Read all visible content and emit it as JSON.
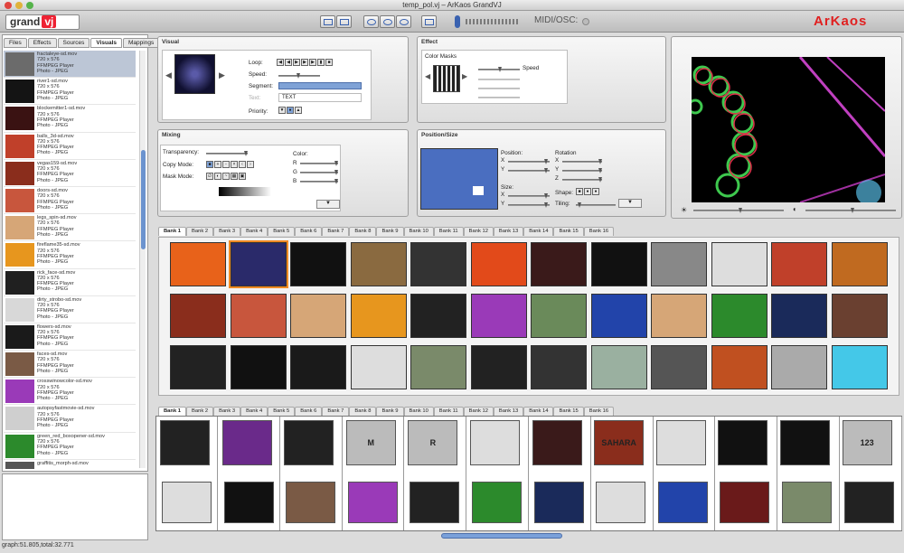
{
  "window": {
    "title": "temp_pol.vj – ArKaos GrandVJ"
  },
  "toolbar": {
    "logo_text": "grand",
    "logo_badge": "vj",
    "midi_label": "MIDI/OSC:",
    "brand": "ArKaos"
  },
  "left_tabs": [
    {
      "label": "Files"
    },
    {
      "label": "Effects"
    },
    {
      "label": "Sources"
    },
    {
      "label": "Visuals"
    },
    {
      "label": "Mappings"
    }
  ],
  "media": [
    {
      "name": "fractaleye-sd.mov",
      "size": "720 x 576",
      "player": "FFMPEG Player",
      "type": "Photo - JPEG",
      "color": "#6b6b6b"
    },
    {
      "name": "river1-sd.mov",
      "size": "720 x 576",
      "player": "FFMPEG Player",
      "type": "Photo - JPEG",
      "color": "#141414"
    },
    {
      "name": "blockemitter1-sd.mov",
      "size": "720 x 576",
      "player": "FFMPEG Player",
      "type": "Photo - JPEG",
      "color": "#3a1212"
    },
    {
      "name": "balls_3d-sd.mov",
      "size": "720 x 576",
      "player": "FFMPEG Player",
      "type": "Photo - JPEG",
      "color": "#c0402a"
    },
    {
      "name": "vegas159-sd.mov",
      "size": "720 x 576",
      "player": "FFMPEG Player",
      "type": "Photo - JPEG",
      "color": "#8a2d1c"
    },
    {
      "name": "doors-sd.mov",
      "size": "720 x 576",
      "player": "FFMPEG Player",
      "type": "Photo - JPEG",
      "color": "#c8563d"
    },
    {
      "name": "legs_spin-sd.mov",
      "size": "720 x 576",
      "player": "FFMPEG Player",
      "type": "Photo - JPEG",
      "color": "#d6a677"
    },
    {
      "name": "fireflame35-sd.mov",
      "size": "720 x 576",
      "player": "FFMPEG Player",
      "type": "Photo - JPEG",
      "color": "#e7961e"
    },
    {
      "name": "rick_face-sd.mov",
      "size": "720 x 576",
      "player": "FFMPEG Player",
      "type": "Photo - JPEG",
      "color": "#202020"
    },
    {
      "name": "dirty_strobo-sd.mov",
      "size": "720 x 576",
      "player": "FFMPEG Player",
      "type": "Photo - JPEG",
      "color": "#d8d8d8"
    },
    {
      "name": "flowers-sd.mov",
      "size": "720 x 576",
      "player": "FFMPEG Player",
      "type": "Photo - JPEG",
      "color": "#1a1a1a"
    },
    {
      "name": "faces-sd.mov",
      "size": "720 x 576",
      "player": "FFMPEG Player",
      "type": "Photo - JPEG",
      "color": "#7a5a45"
    },
    {
      "name": "crosswinowcolor-sd.mov",
      "size": "720 x 576",
      "player": "FFMPEG Player",
      "type": "Photo - JPEG",
      "color": "#9a3ab8"
    },
    {
      "name": "autopsyfastmovie-sd.mov",
      "size": "720 x 576",
      "player": "FFMPEG Player",
      "type": "Photo - JPEG",
      "color": "#cfcfcf"
    },
    {
      "name": "green_red_boxopener-sd.mov",
      "size": "720 x 576",
      "player": "FFMPEG Player",
      "type": "Photo - JPEG",
      "color": "#2c8a2c"
    },
    {
      "name": "graffitis_morph-sd.mov",
      "size": "",
      "player": "",
      "type": "",
      "color": "#555"
    }
  ],
  "status": "graph:51.805,total:32.771",
  "visual": {
    "header": "Visual",
    "loop": "Loop:",
    "speed": "Speed:",
    "segment": "Segment:",
    "text_lbl": "Text:",
    "text_value": "TEXT",
    "priority": "Priority:"
  },
  "effect": {
    "header": "Effect",
    "mask_label": "Color Masks",
    "speed": "Speed"
  },
  "mixing": {
    "header": "Mixing",
    "transparency": "Transparency:",
    "copy": "Copy Mode:",
    "mask": "Mask Mode:",
    "color": "Color:",
    "r": "R",
    "g": "G",
    "b": "B"
  },
  "position": {
    "header": "Position/Size",
    "position": "Position:",
    "rotation": "Rotation",
    "size": "Size:",
    "shape": "Shape:",
    "tiling": "Tiling:",
    "x": "X",
    "y": "Y",
    "z": "Z"
  },
  "banks": [
    "Bank 1",
    "Bank 2",
    "Bank 3",
    "Bank 4",
    "Bank 5",
    "Bank 6",
    "Bank 7",
    "Bank 8",
    "Bank 9",
    "Bank 10",
    "Bank 11",
    "Bank 12",
    "Bank 13",
    "Bank 14",
    "Bank 15",
    "Bank 16"
  ],
  "grid_colors": [
    "#e8621a",
    "#2a2a6a",
    "#111",
    "#8a6a40",
    "#333",
    "#e24a1a",
    "#3a1a1a",
    "#111",
    "#888",
    "#ddd",
    "#c0402a",
    "#c06a20",
    "#8a2d1c",
    "#c8563d",
    "#d6a677",
    "#e7961e",
    "#222",
    "#9a3ab8",
    "#6a8a5a",
    "#2244aa",
    "#d6a677",
    "#2c8a2c",
    "#1a2a5a",
    "#6a4030",
    "#222",
    "#111",
    "#1a1a1a",
    "#ddd",
    "#7a8a6a",
    "#222",
    "#333",
    "#9ab0a0",
    "#555",
    "#c05020",
    "#aaa",
    "#44c8e8"
  ],
  "key_top": [
    {
      "label": "",
      "color": "#222"
    },
    {
      "label": "",
      "color": "#6a2a8a"
    },
    {
      "label": "",
      "color": "#222"
    },
    {
      "label": "M",
      "color": "#bbb"
    },
    {
      "label": "R",
      "color": "#bbb"
    },
    {
      "label": "",
      "color": "#ddd"
    },
    {
      "label": "",
      "color": "#3a1a1a"
    },
    {
      "label": "SAHARA",
      "color": "#8a2d1c"
    },
    {
      "label": "",
      "color": "#ddd"
    },
    {
      "label": "",
      "color": "#111"
    },
    {
      "label": "",
      "color": "#111"
    },
    {
      "label": "123",
      "color": "#bbb"
    }
  ],
  "key_bottom": [
    "#ddd",
    "#111",
    "#7a5a45",
    "#9a3ab8",
    "#222",
    "#2c8a2c",
    "#1a2a5a",
    "#ddd",
    "#2244aa",
    "#6a1a1a",
    "#7a8a6a",
    "#222"
  ]
}
